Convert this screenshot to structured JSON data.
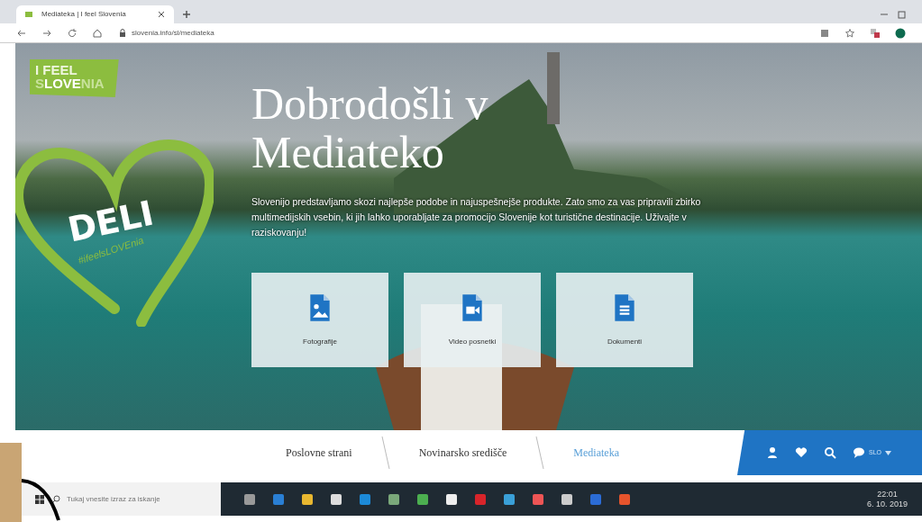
{
  "browser": {
    "tab_title": "Mediateka | I feel Slovenia",
    "url": "slovenia.info/sl/mediateka"
  },
  "hero": {
    "logo": {
      "line1": "I FEEL",
      "line2": "S**LOVE**NIA"
    },
    "badge": {
      "word": "DELI",
      "hashtag": "#ifeelsLOVEnia"
    },
    "title": "Dobrodošli v Mediateko",
    "intro": "Slovenijo predstavljamo skozi najlepše podobe in najuspešnejše produkte. Zato smo za vas pripravili zbirko multimedijskih vsebin, ki jih lahko uporabljate za promocijo Slovenije kot turistične destinacije. Uživajte v raziskovanju!",
    "tiles": [
      {
        "kind": "photo",
        "label": "Fotografije"
      },
      {
        "kind": "video",
        "label": "Video posnetki"
      },
      {
        "kind": "document",
        "label": "Dokumenti"
      }
    ]
  },
  "nav": {
    "items": [
      {
        "label": "Poslovne strani",
        "selected": false
      },
      {
        "label": "Novinarsko središče",
        "selected": false
      },
      {
        "label": "Mediateka",
        "selected": true
      }
    ],
    "language": "SLO"
  },
  "taskbar": {
    "search_placeholder": "Tukaj vnesite izraz za iskanje",
    "time": "22:01",
    "date": "6. 10. 2019"
  }
}
